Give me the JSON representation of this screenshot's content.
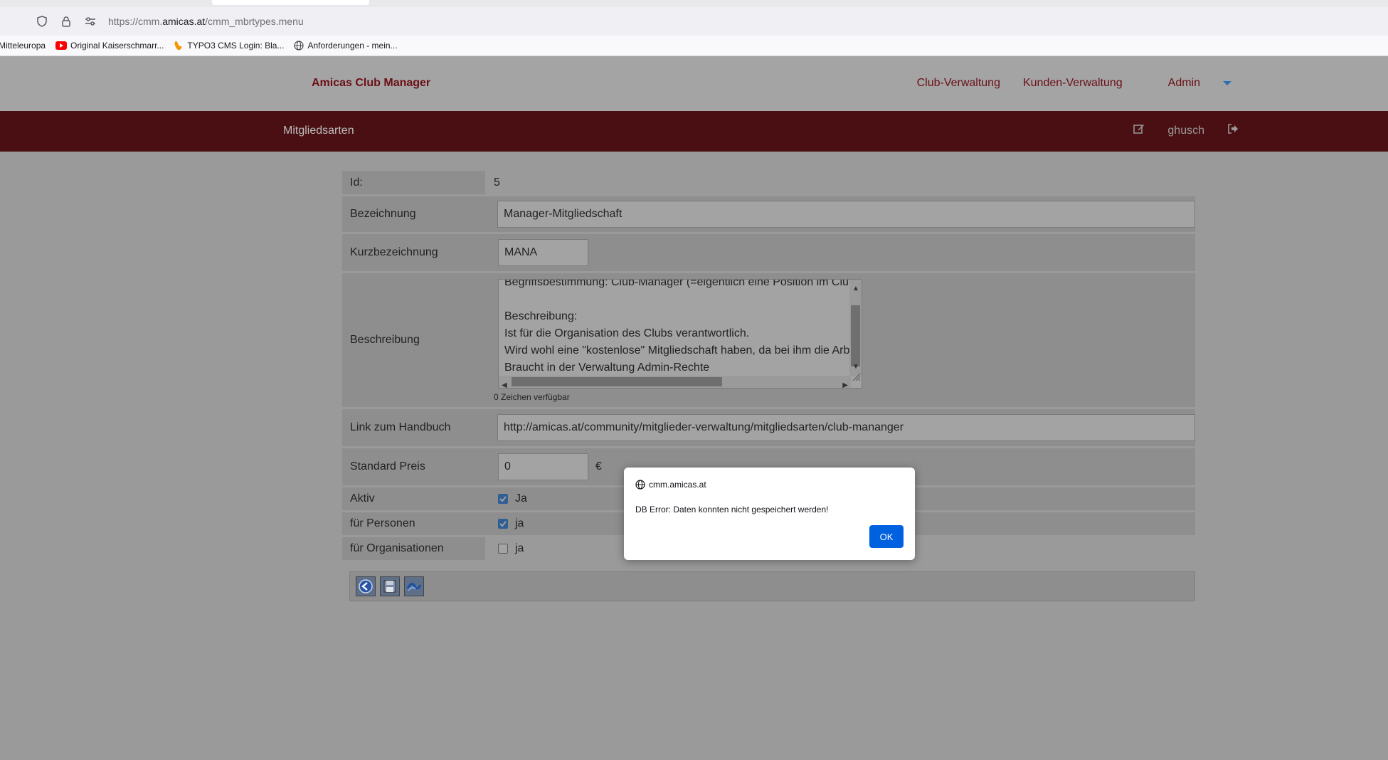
{
  "browser": {
    "url_prefix": "https://cmm.",
    "url_domain": "amicas.at",
    "url_path": "/cmm_mbrtypes.menu",
    "bookmarks": [
      {
        "label": "Mitteleuropa"
      },
      {
        "label": "Original Kaiserschmarr..."
      },
      {
        "label": "TYPO3 CMS Login: Bla..."
      },
      {
        "label": "Anforderungen - mein..."
      }
    ]
  },
  "header": {
    "brand": "Amicas Club Manager",
    "nav": [
      "Club-Verwaltung",
      "Kunden-Verwaltung",
      "Admin"
    ]
  },
  "subbar": {
    "title": "Mitgliedsarten",
    "user": "ghusch"
  },
  "form": {
    "id_label": "Id:",
    "id_value": "5",
    "bezeichnung_label": "Bezeichnung",
    "bezeichnung_value": "Manager-Mitgliedschaft",
    "kurz_label": "Kurzbezeichnung",
    "kurz_value": "MANA",
    "beschreibung_label": "Beschreibung",
    "beschreibung_lines": [
      "Begriffsbestimmung: Club-Manager (=eigentlich eine Position im Club)",
      "",
      "Beschreibung:",
      "Ist für die Organisation des Clubs verantwortlich.",
      "Wird wohl eine \"kostenlose\" Mitgliedschaft haben, da bei ihm die Arbeit",
      "Braucht in der Verwaltung Admin-Rechte"
    ],
    "counter": "0 Zeichen verfügbar",
    "link_label": "Link zum Handbuch",
    "link_value": "http://amicas.at/community/mitglieder-verwaltung/mitgliedsarten/club-mananger",
    "preis_label": "Standard Preis",
    "preis_value": "0",
    "currency": "€",
    "aktiv_label": "Aktiv",
    "aktiv_text": "Ja",
    "personen_label": "für Personen",
    "personen_text": "ja",
    "org_label": "für Organisationen",
    "org_text": "ja"
  },
  "dialog": {
    "origin": "cmm.amicas.at",
    "message": "DB Error: Daten konnten nicht gespeichert werden!",
    "ok": "OK"
  },
  "colors": {
    "brand": "#6b0f16",
    "subbar": "#4a0f12",
    "ok_button": "#0061e0"
  }
}
